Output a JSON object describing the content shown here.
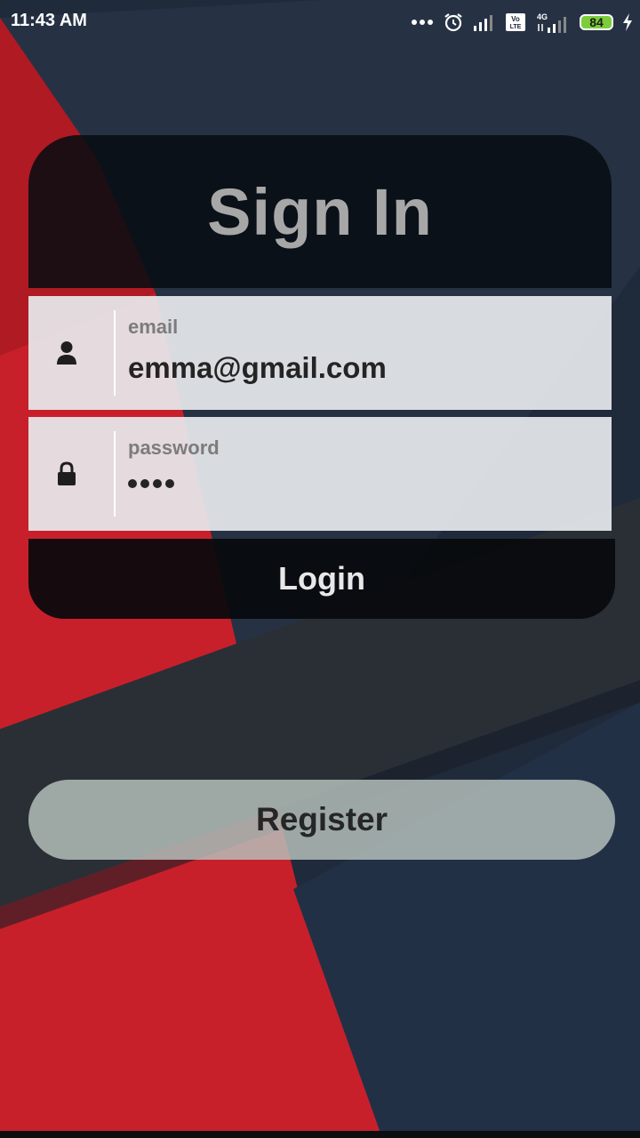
{
  "status_bar": {
    "time": "11:43 AM",
    "battery_level": "84",
    "network_label": "4G",
    "volte_label": "Vo LTE",
    "icons": [
      "more-dots-icon",
      "alarm-icon",
      "signal-icon",
      "volte-icon",
      "signal-4g-icon",
      "battery-icon",
      "charging-icon"
    ]
  },
  "login_card": {
    "title": "Sign In",
    "email": {
      "label": "email",
      "value": "emma@gmail.com",
      "icon": "person-icon"
    },
    "password": {
      "label": "password",
      "masked_length": 4,
      "icon": "lock-icon"
    },
    "login_label": "Login"
  },
  "register": {
    "label": "Register"
  },
  "colors": {
    "red_accent": "#c8202a",
    "dark_navy": "#1f2a3a",
    "card_dark": "#080c12",
    "field_bg": "#e7eaee",
    "register_bg": "#b8c3be"
  }
}
